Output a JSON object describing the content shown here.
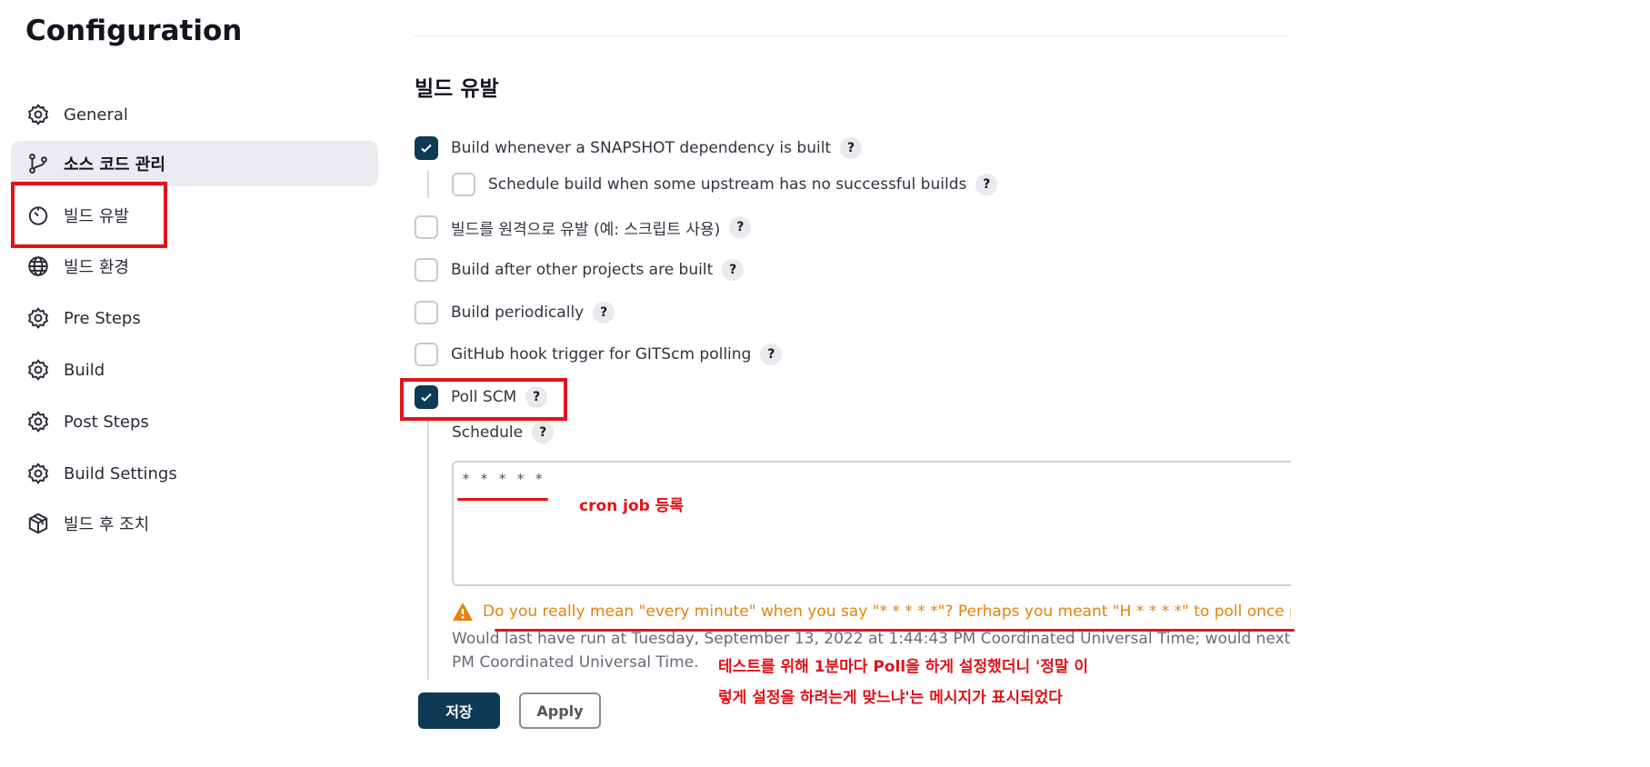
{
  "page_title": "Configuration",
  "sidebar": {
    "items": [
      {
        "label": "General",
        "icon": "gear-icon"
      },
      {
        "label": "소스 코드 관리",
        "icon": "branch-icon",
        "active": true
      },
      {
        "label": "빌드 유발",
        "icon": "timer-icon"
      },
      {
        "label": "빌드 환경",
        "icon": "globe-icon"
      },
      {
        "label": "Pre Steps",
        "icon": "gear-icon"
      },
      {
        "label": "Build",
        "icon": "gear-icon"
      },
      {
        "label": "Post Steps",
        "icon": "gear-icon"
      },
      {
        "label": "Build Settings",
        "icon": "gear-icon"
      },
      {
        "label": "빌드 후 조치",
        "icon": "package-icon"
      }
    ]
  },
  "section": {
    "title": "빌드 유발",
    "options": [
      {
        "label": "Build whenever a SNAPSHOT dependency is built",
        "checked": true
      },
      {
        "label": "Schedule build when some upstream has no successful builds",
        "checked": false
      },
      {
        "label": "빌드를 원격으로 유발 (예: 스크립트 사용)",
        "checked": false
      },
      {
        "label": "Build after other projects are built",
        "checked": false
      },
      {
        "label": "Build periodically",
        "checked": false
      },
      {
        "label": "GitHub hook trigger for GITScm polling",
        "checked": false
      },
      {
        "label": "Poll SCM",
        "checked": true
      }
    ],
    "help_glyph": "?",
    "schedule": {
      "label": "Schedule",
      "value": "* * * * *",
      "warning": "Do you really mean \"every minute\" when you say \"* * * * *\"? Perhaps you meant \"H * * * *\" to poll once per hour",
      "info_line1": "Would last have run at Tuesday, September 13, 2022 at 1:44:43 PM Coordinated Universal Time; would next run at Tues",
      "info_line2": "PM Coordinated Universal Time."
    }
  },
  "buttons": {
    "save": "저장",
    "apply": "Apply"
  },
  "annotations": {
    "cron_note": "cron job 등록",
    "note_line1": "테스트를 위해 1분마다 Poll을 하게 설정했더니 '정말 이",
    "note_line2": "렇게 설정을 하려는게 맞느냐'는 메시지가 표시되었다"
  },
  "colors": {
    "accent": "#0e3a55",
    "annotation": "#e0131b",
    "warning": "#e3830e"
  }
}
